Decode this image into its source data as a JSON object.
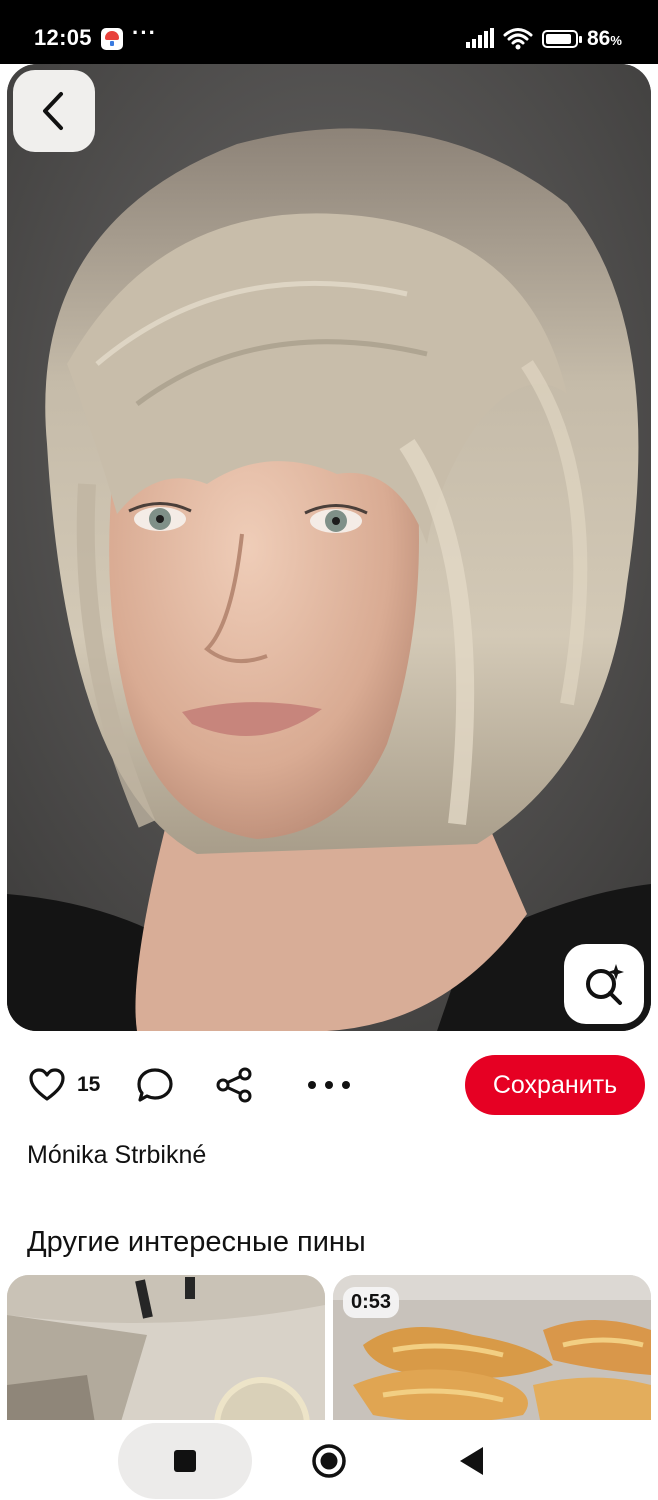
{
  "status_bar": {
    "time": "12:05",
    "dots": "···",
    "battery_percent": "86",
    "battery_unit": "%",
    "icons": [
      "app-notification-icon",
      "signal-icon",
      "wifi-icon",
      "battery-icon"
    ]
  },
  "hero": {
    "description": "portrait photo",
    "back_icon": "chevron-left-icon",
    "lens_icon": "visual-search-icon"
  },
  "actions": {
    "like_count": "15",
    "icons": [
      "heart-icon",
      "comment-icon",
      "share-icon",
      "more-icon"
    ],
    "save_label": "Сохранить",
    "save_color": "#e60023"
  },
  "author": {
    "name": "Mónika Strbikné"
  },
  "more_pins": {
    "title": "Другие интересные пины",
    "tiles": [
      {
        "kind": "image"
      },
      {
        "kind": "video",
        "duration": "0:53"
      }
    ]
  },
  "nav": {
    "icons": [
      "recent-apps-icon",
      "home-icon",
      "back-triangle-icon"
    ]
  }
}
